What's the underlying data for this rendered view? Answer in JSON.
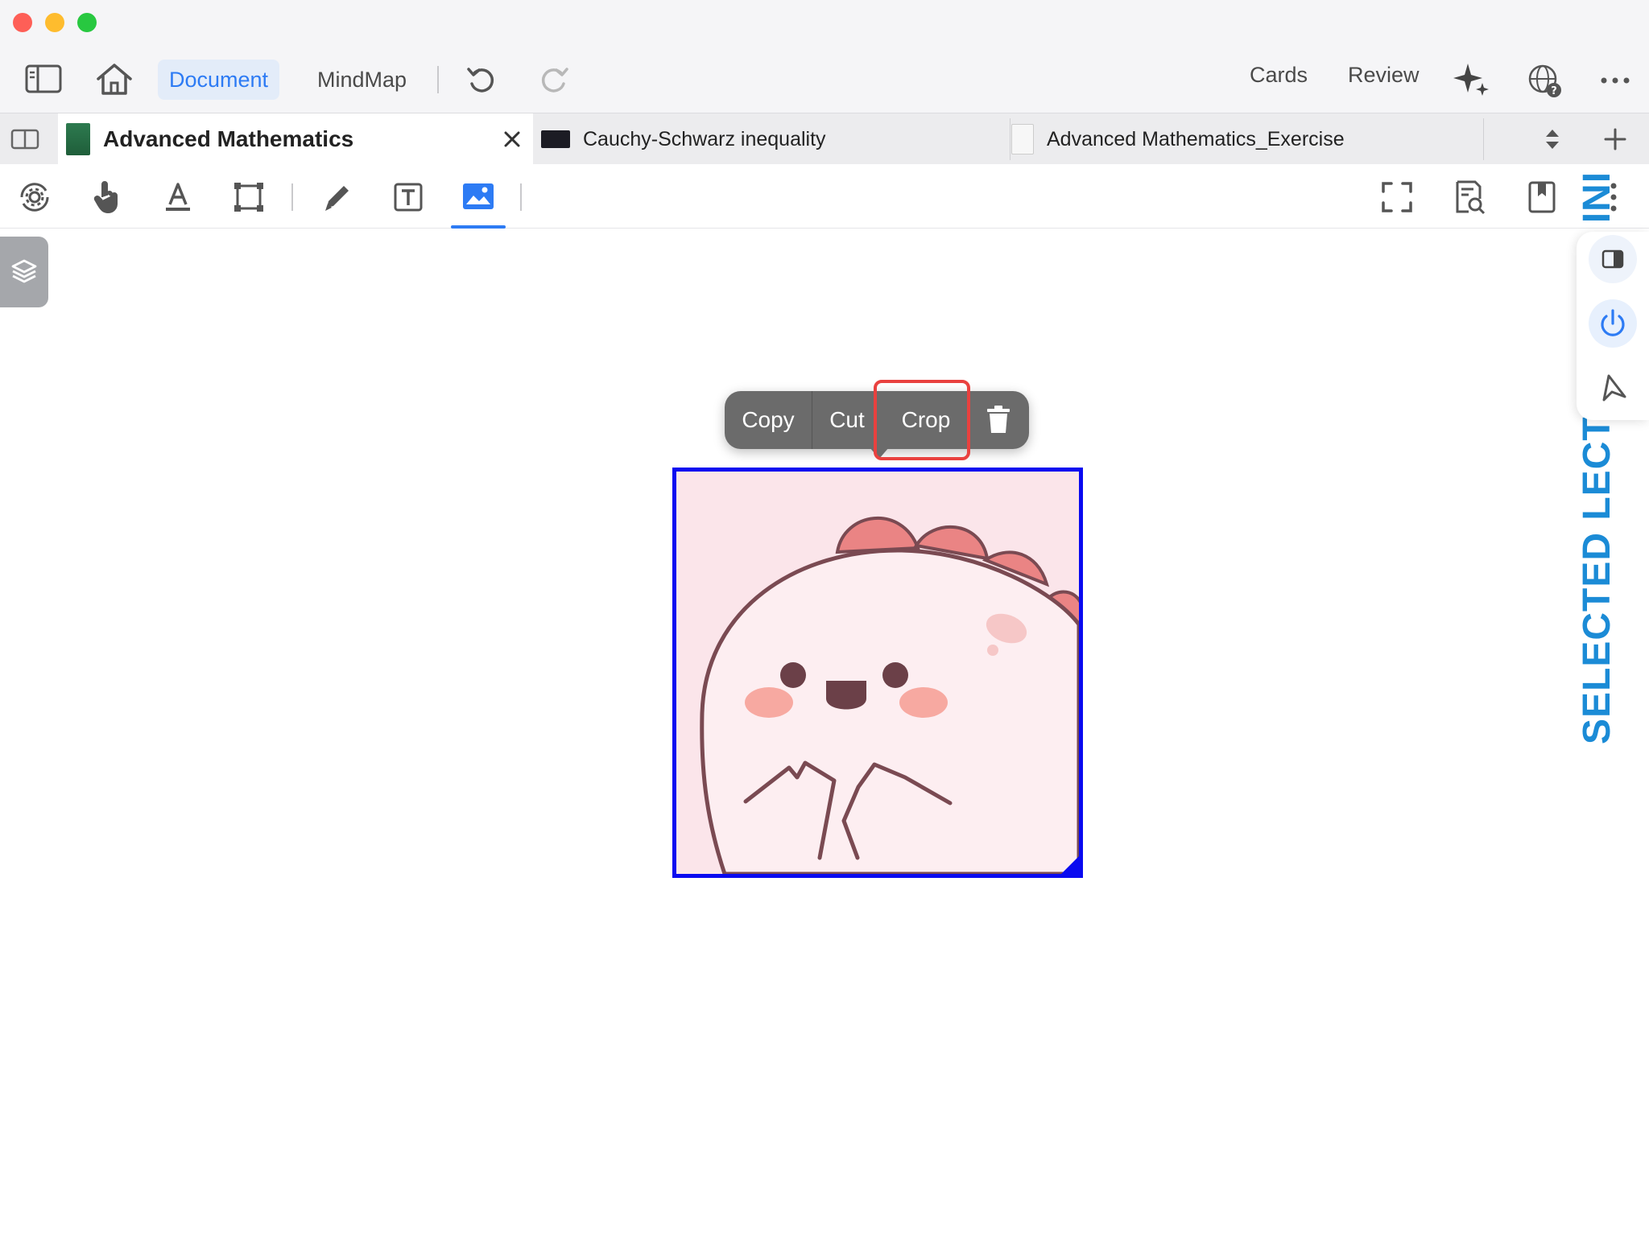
{
  "topbar": {
    "tabs": [
      {
        "label": "Document",
        "active": true
      },
      {
        "label": "MindMap",
        "active": false
      }
    ],
    "right_links": {
      "cards": "Cards",
      "review": "Review"
    }
  },
  "doc_tabs": [
    {
      "title": "Advanced Mathematics",
      "active": true
    },
    {
      "title": "Cauchy-Schwarz inequality",
      "active": false
    },
    {
      "title": "Advanced Mathematics_Exercise",
      "active": false
    }
  ],
  "toolbar": {
    "active_tool": "image-tool"
  },
  "context_menu": {
    "copy": "Copy",
    "cut": "Cut",
    "crop": "Crop",
    "highlighted": "crop"
  },
  "page_content": {
    "vertical_text": "SELECTED LECTURES ON INI"
  },
  "colors": {
    "accent": "#2d7bf4",
    "selection": "#0a0af0",
    "highlight": "#e9413f",
    "vertical_text": "#1b8bd6"
  }
}
